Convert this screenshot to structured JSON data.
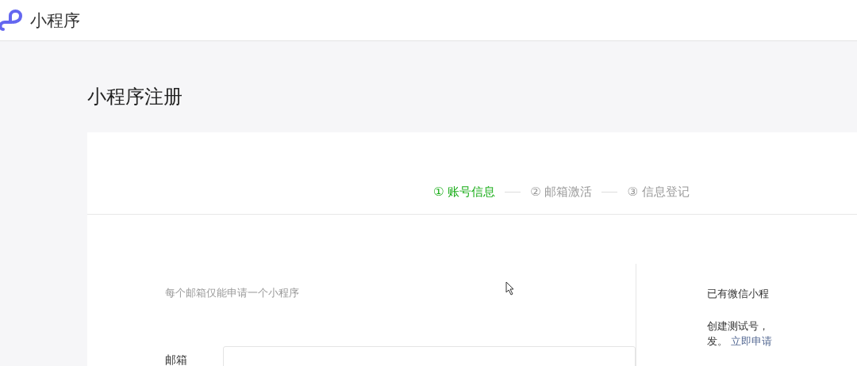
{
  "header": {
    "title": "小程序"
  },
  "page": {
    "title": "小程序注册"
  },
  "steps": [
    {
      "number": "①",
      "label": "账号信息",
      "selected": true
    },
    {
      "number": "②",
      "label": "邮箱激活",
      "selected": false
    },
    {
      "number": "③",
      "label": "信息登记",
      "selected": false
    }
  ],
  "form": {
    "hint": "每个邮箱仅能申请一个小程序",
    "fields": [
      {
        "label": "邮箱"
      }
    ]
  },
  "side": {
    "line_1": "已有微信小程",
    "line_2": "创建测试号，",
    "line_3": "发。",
    "link": "立即申请"
  }
}
